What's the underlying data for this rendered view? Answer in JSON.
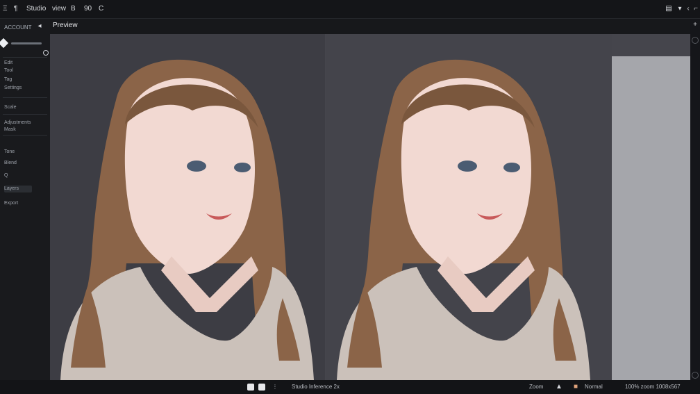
{
  "topbar": {
    "items": [
      "Ξ",
      "¶",
      "Studio",
      "view",
      "B",
      "90",
      "C"
    ],
    "right_icons": [
      "menu-icon",
      "cursor-icon",
      "chevron-icon",
      "maximize-icon"
    ]
  },
  "sidebar": {
    "header": "ACCOUNT",
    "rows": [
      "Edit",
      "Tool",
      "Tag",
      "Settings",
      "Scale",
      "Adjustments",
      "Mask",
      "Tone",
      "Blend",
      "Q",
      "Layers",
      "Export"
    ]
  },
  "tab": {
    "title": "Preview"
  },
  "bottombar": {
    "center_text": "Studio Inference 2x",
    "right_labels": [
      "Zoom",
      "Normal",
      "100% zoom   1008x567"
    ]
  },
  "colors": {
    "canvas": "#45454c",
    "panel_left": "#3d3d44",
    "panel_right": "#44444b",
    "grey_block": "#a5a6ab",
    "hair": "#8b6448",
    "skin": "#f2d9d2",
    "sweater": "#cbc1ba"
  }
}
